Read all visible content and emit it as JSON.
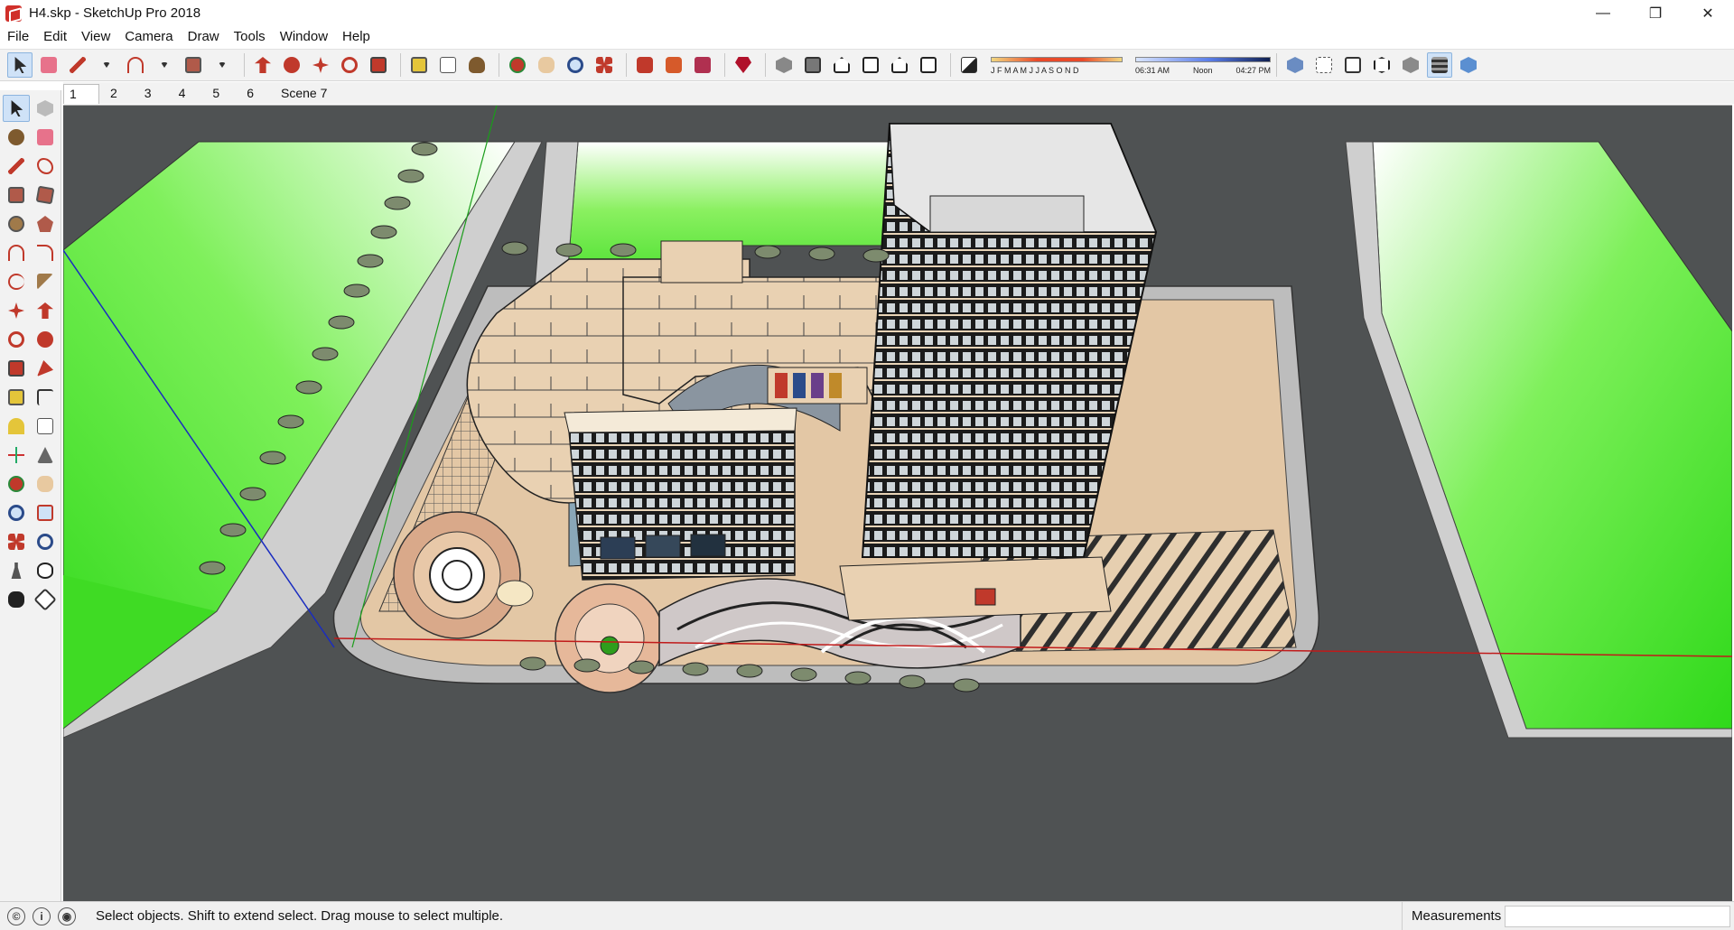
{
  "window": {
    "title": "H4.skp - SketchUp Pro 2018",
    "controls": [
      "—",
      "❐",
      "✕"
    ]
  },
  "menu": [
    "File",
    "Edit",
    "View",
    "Camera",
    "Draw",
    "Tools",
    "Window",
    "Help"
  ],
  "toolbar": {
    "months_label": "J F M A M J J A S O N D",
    "time_start": "06:31 AM",
    "time_mid": "Noon",
    "time_end": "04:27 PM"
  },
  "scenes": [
    "1",
    "2",
    "3",
    "4",
    "5",
    "6",
    "Scene 7"
  ],
  "status": {
    "hint": "Select objects. Shift to extend select. Drag mouse to select multiple.",
    "measurements_label": "Measurements",
    "measurements_value": ""
  },
  "colors": {
    "accent": "#cfe2f7",
    "grass": "#38e01c",
    "road": "#4f5253",
    "building": "#e8d3b6"
  }
}
